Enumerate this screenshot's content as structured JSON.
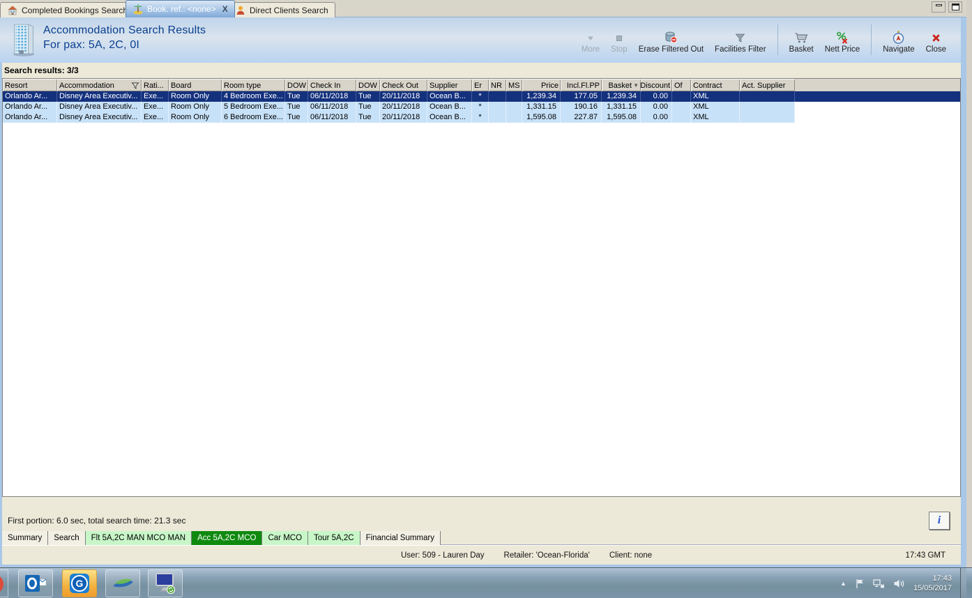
{
  "window": {
    "tabs": [
      {
        "label": "Completed Bookings Search",
        "icon": "bookings-icon",
        "active": false,
        "closable": false
      },
      {
        "label": "Book. ref.: <none>",
        "icon": "palm-icon",
        "active": true,
        "closable": true,
        "close_glyph": "X"
      },
      {
        "label": "Direct Clients Search",
        "icon": "client-icon",
        "active": false,
        "closable": false
      }
    ]
  },
  "header": {
    "icon": "hotel-building-icon",
    "title_line1": "Accommodation Search Results",
    "title_line2": "For pax: 5A, 2C, 0I",
    "toolbar": [
      {
        "label": "More",
        "icon": "more-icon",
        "disabled": true
      },
      {
        "label": "Stop",
        "icon": "stop-icon",
        "disabled": true
      },
      {
        "label": "Erase Filtered Out",
        "icon": "erase-icon"
      },
      {
        "label": "Facilities Filter",
        "icon": "facilities-icon"
      },
      {
        "label": "Basket",
        "icon": "basket-icon",
        "sep_before": true
      },
      {
        "label": "Nett Price",
        "icon": "nettprice-icon"
      },
      {
        "label": "Navigate",
        "icon": "navigate-icon",
        "sep_before": true
      },
      {
        "label": "Close",
        "icon": "close-icon"
      }
    ]
  },
  "results": {
    "summary": "Search results: 3/3",
    "columns": [
      "Resort",
      "Accommodation",
      "Rati...",
      "Board",
      "Room type",
      "DOW",
      "Check In",
      "DOW",
      "Check Out",
      "Supplier",
      "Er",
      "NR",
      "MS",
      "Price",
      "Incl.Fl.PP",
      "Basket",
      "Discount",
      "Of",
      "Contract",
      "Act. Supplier"
    ],
    "rows": [
      [
        "Orlando Ar...",
        "Disney Area Executiv...",
        "Exe...",
        "Room Only",
        "4 Bedroom Exe...",
        "Tue",
        "06/11/2018",
        "Tue",
        "20/11/2018",
        "Ocean B...",
        "*",
        "",
        "",
        "1,239.34",
        "177.05",
        "1,239.34",
        "0.00",
        "",
        "XML",
        ""
      ],
      [
        "Orlando Ar...",
        "Disney Area Executiv...",
        "Exe...",
        "Room Only",
        "5 Bedroom Exe...",
        "Tue",
        "06/11/2018",
        "Tue",
        "20/11/2018",
        "Ocean B...",
        "*",
        "",
        "",
        "1,331.15",
        "190.16",
        "1,331.15",
        "0.00",
        "",
        "XML",
        ""
      ],
      [
        "Orlando Ar...",
        "Disney Area Executiv...",
        "Exe...",
        "Room Only",
        "6 Bedroom Exe...",
        "Tue",
        "06/11/2018",
        "Tue",
        "20/11/2018",
        "Ocean B...",
        "*",
        "",
        "",
        "1,595.08",
        "227.87",
        "1,595.08",
        "0.00",
        "",
        "XML",
        ""
      ]
    ],
    "selected_row_index": 0
  },
  "footer": {
    "timing": "First portion: 6.0 sec, total search time: 21.3 sec",
    "info_button": "i"
  },
  "bottom_tabs": [
    {
      "label": "Summary",
      "style": "plain"
    },
    {
      "label": "Search",
      "style": "plain"
    },
    {
      "label": "Flt 5A,2C MAN MCO MAN",
      "style": "green"
    },
    {
      "label": "Acc 5A,2C MCO",
      "style": "active-green"
    },
    {
      "label": "Car MCO",
      "style": "green"
    },
    {
      "label": "Tour 5A,2C",
      "style": "green"
    },
    {
      "label": "Financial Summary",
      "style": "plain"
    }
  ],
  "status_bar": {
    "user": "User: 509 - Lauren Day",
    "retailer": "Retailer: 'Ocean-Florida'",
    "client": "Client: none",
    "time": "17:43 GMT"
  },
  "taskbar": {
    "clock_time": "17:43",
    "clock_date": "15/05/2017"
  },
  "colors": {
    "selected_row": "#14317E",
    "row_alt": "#C7E1F8",
    "grid_header": "#D8D4CA",
    "chrome_beige": "#ECE9D8",
    "active_bottom_tab": "#0F8A0F",
    "bottom_tab_green": "#C8F6C8",
    "title_text": "#0A3F8E"
  }
}
